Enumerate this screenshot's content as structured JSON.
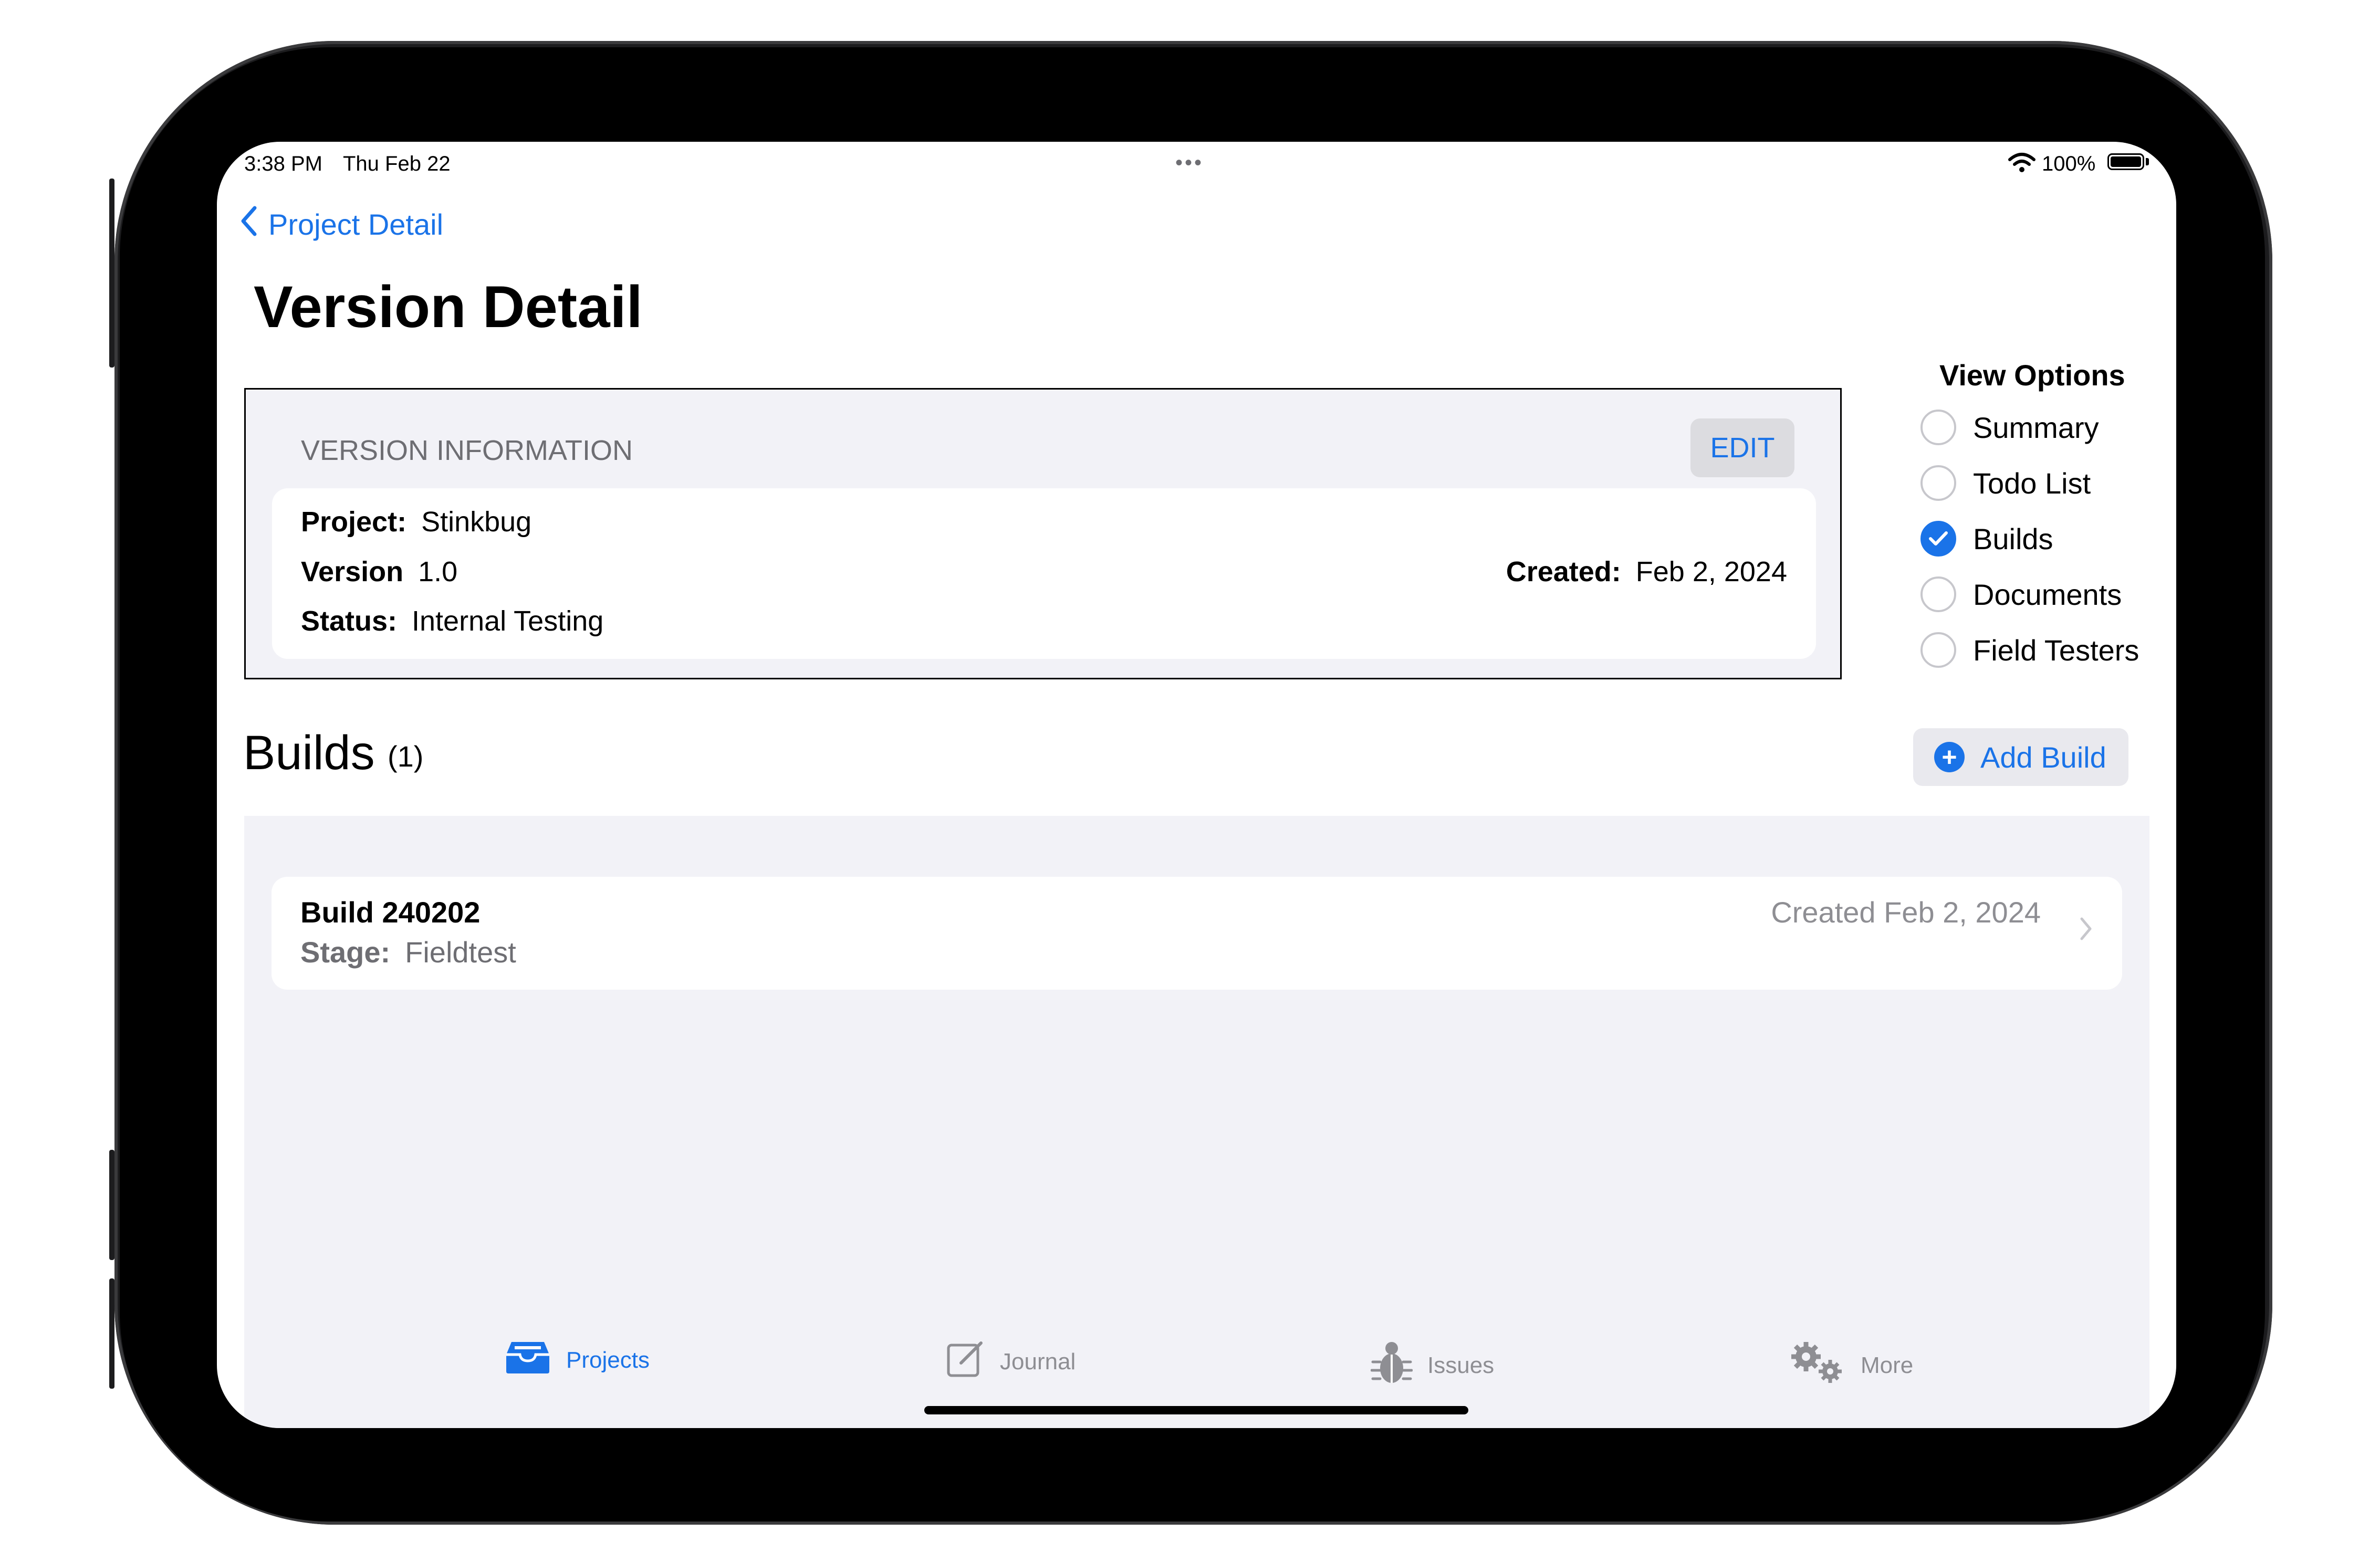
{
  "status_bar": {
    "time": "3:38 PM",
    "date": "Thu Feb 22",
    "multitask": "•••",
    "battery": "100%",
    "icons": [
      "wifi-icon",
      "battery-icon"
    ]
  },
  "nav": {
    "back_label": "Project Detail",
    "title": "Version Detail"
  },
  "version_info": {
    "header": "VERSION INFORMATION",
    "edit_label": "EDIT",
    "project_label": "Project:",
    "project_value": "Stinkbug",
    "version_label": "Version",
    "version_value": "1.0",
    "status_label": "Status:",
    "status_value": "Internal Testing",
    "created_label": "Created:",
    "created_value": "Feb 2, 2024"
  },
  "view_options": {
    "title": "View Options",
    "options": [
      {
        "label": "Summary",
        "checked": false
      },
      {
        "label": "Todo List",
        "checked": false
      },
      {
        "label": "Builds",
        "checked": true
      },
      {
        "label": "Documents",
        "checked": false
      },
      {
        "label": "Field Testers",
        "checked": false
      }
    ]
  },
  "builds": {
    "title": "Builds",
    "count": "(1)",
    "add_label": "Add Build",
    "items": [
      {
        "name": "Build 240202",
        "stage_label": "Stage:",
        "stage_value": "Fieldtest",
        "created": "Created Feb 2, 2024"
      }
    ]
  },
  "tabs": [
    {
      "label": "Projects",
      "icon": "tray-icon",
      "active": true
    },
    {
      "label": "Journal",
      "icon": "compose-icon",
      "active": false
    },
    {
      "label": "Issues",
      "icon": "bug-icon",
      "active": false
    },
    {
      "label": "More",
      "icon": "gears-icon",
      "active": false
    }
  ],
  "colors": {
    "accent": "#1a73e8",
    "grouped_background": "#f2f2f7",
    "secondary_text": "#8e8e93"
  }
}
